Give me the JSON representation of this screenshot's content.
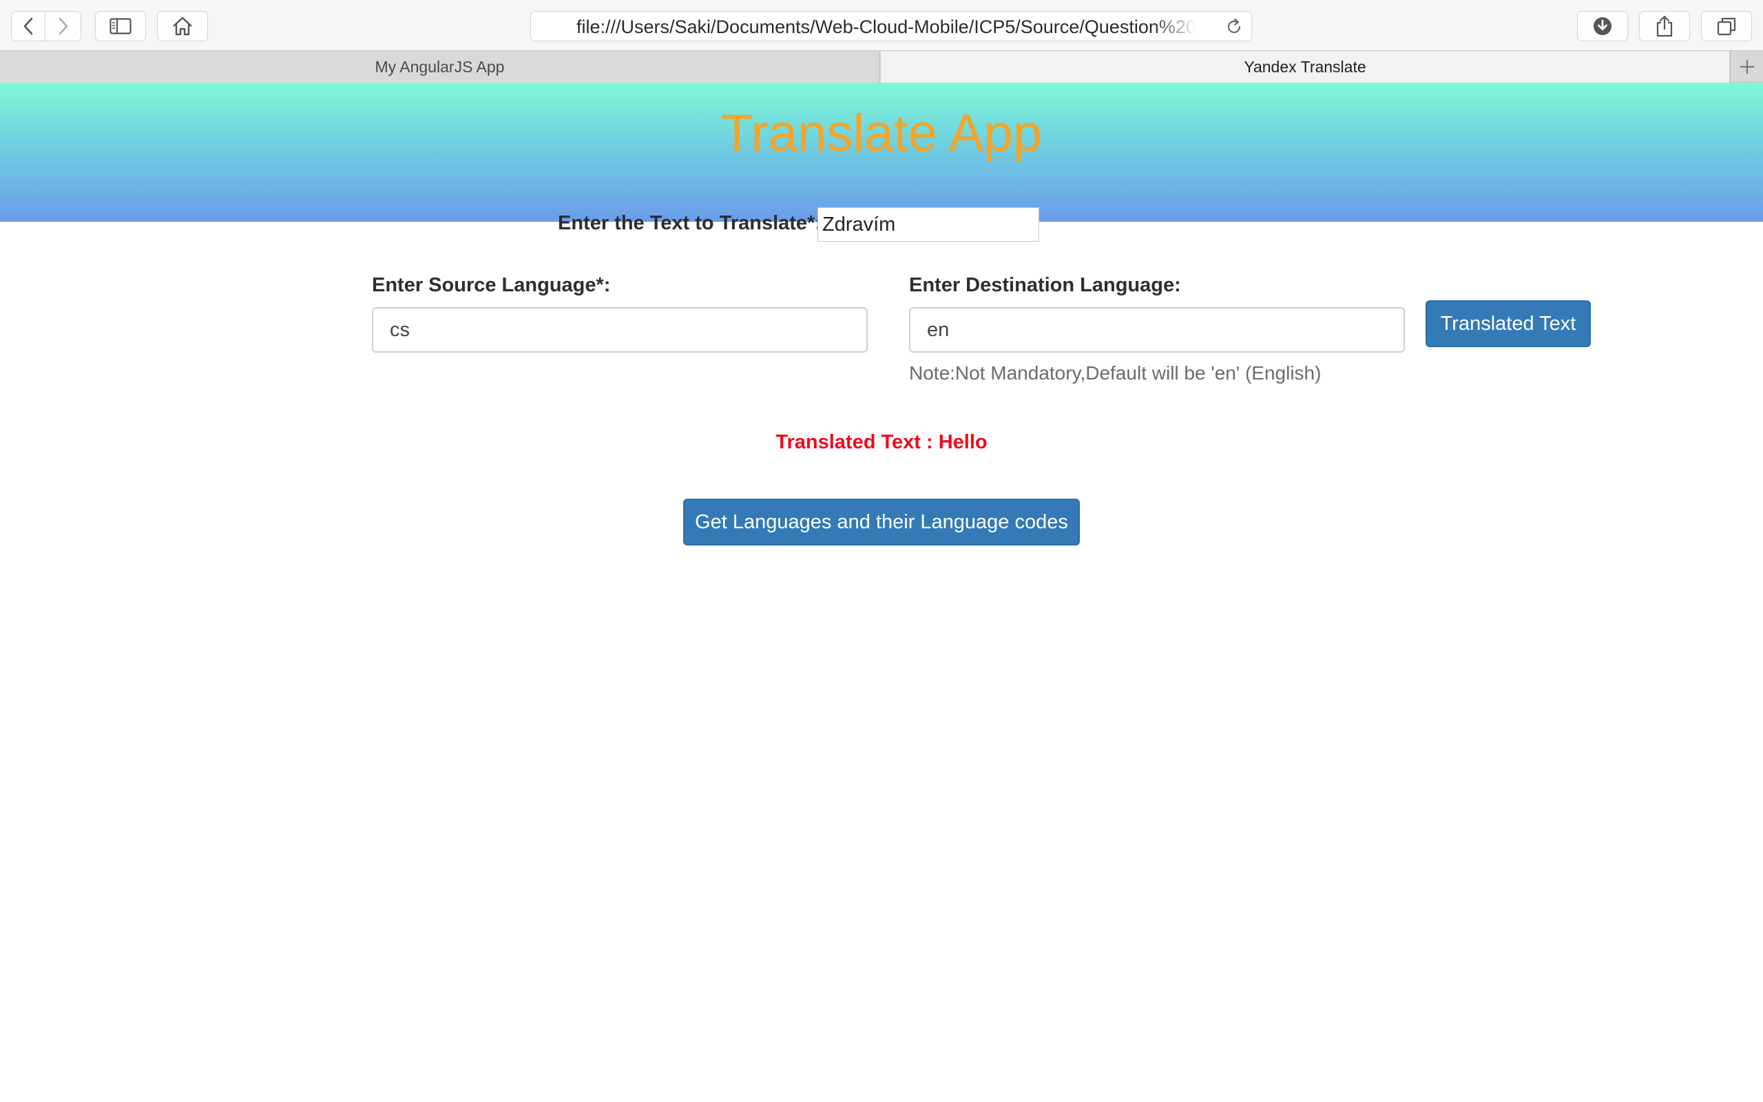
{
  "browser": {
    "address_url": "file:///Users/Saki/Documents/Web-Cloud-Mobile/ICP5/Source/Question%202/translate.html",
    "tabs": [
      {
        "label": "My AngularJS App",
        "active": false
      },
      {
        "label": "Yandex Translate",
        "active": true
      }
    ],
    "icons": [
      "chevron-left-icon",
      "chevron-right-icon",
      "sidebar-icon",
      "home-icon",
      "reload-icon",
      "download-icon",
      "share-icon",
      "tabs-overview-icon",
      "plus-icon"
    ]
  },
  "page": {
    "title": "Translate App",
    "title_color": "#f6a326",
    "header_gradient": [
      "#7ff8d6",
      "#6b9ce9"
    ],
    "text_label": "Enter the Text to Translate*:",
    "text_value": "Zdravím",
    "source_label": "Enter Source Language*:",
    "source_value": "cs",
    "dest_label": "Enter Destination Language:",
    "dest_value": "en",
    "note": "Note:Not Mandatory,Default will be 'en' (English)",
    "translate_button": "Translated Text",
    "result": "Translated Text : Hello",
    "result_color": "#f2071b",
    "languages_button": "Get Languages and their Language codes",
    "button_color": "#337ab7"
  }
}
